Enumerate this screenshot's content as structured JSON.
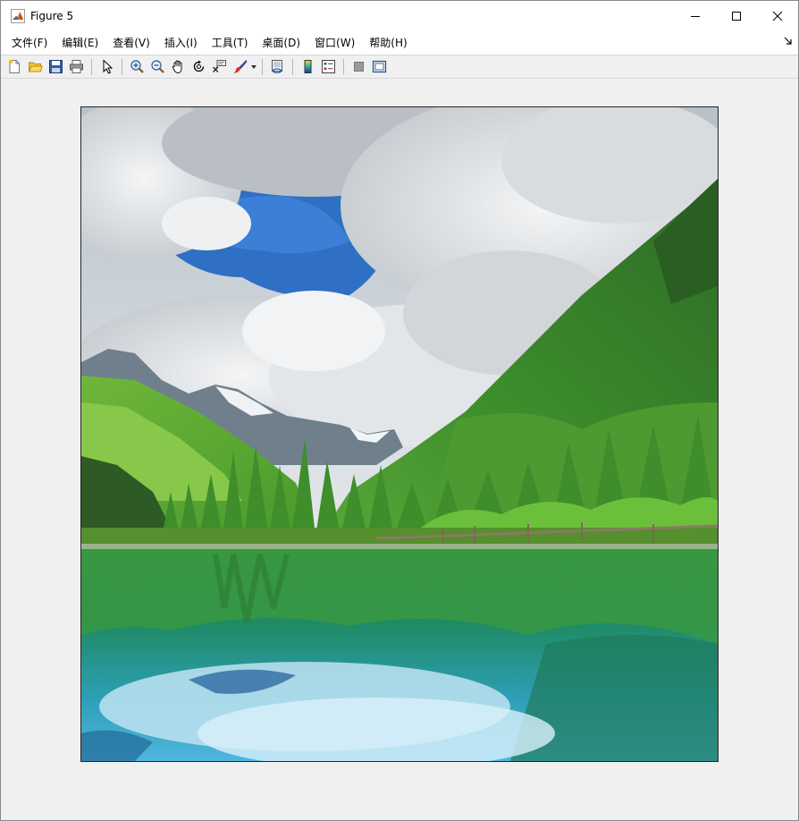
{
  "window": {
    "title": "Figure 5",
    "controls": {
      "minimize": "minimize",
      "maximize": "maximize",
      "close": "close"
    }
  },
  "menubar": {
    "items": [
      {
        "id": "file",
        "label": "文件(F)"
      },
      {
        "id": "edit",
        "label": "编辑(E)"
      },
      {
        "id": "view",
        "label": "查看(V)"
      },
      {
        "id": "insert",
        "label": "插入(I)"
      },
      {
        "id": "tools",
        "label": "工具(T)"
      },
      {
        "id": "desktop",
        "label": "桌面(D)"
      },
      {
        "id": "window",
        "label": "窗口(W)"
      },
      {
        "id": "help",
        "label": "帮助(H)"
      }
    ]
  },
  "toolbar": {
    "buttons": [
      "new-figure-icon",
      "open-file-icon",
      "save-icon",
      "print-icon",
      "select-arrow-icon",
      "zoom-in-icon",
      "zoom-out-icon",
      "pan-hand-icon",
      "rotate-3d-icon",
      "data-cursor-icon",
      "brush-icon",
      "link-plot-icon",
      "colorbar-icon",
      "legend-icon",
      "hide-plot-tools-icon",
      "show-plot-tools-icon"
    ]
  },
  "figure": {
    "image_subject": "mountain lake landscape"
  },
  "colors": {
    "window_bg": "#f0f0f0",
    "titlebar_bg": "#ffffff",
    "matlab_orange": "#e2611a",
    "axes_border": "#262626"
  }
}
